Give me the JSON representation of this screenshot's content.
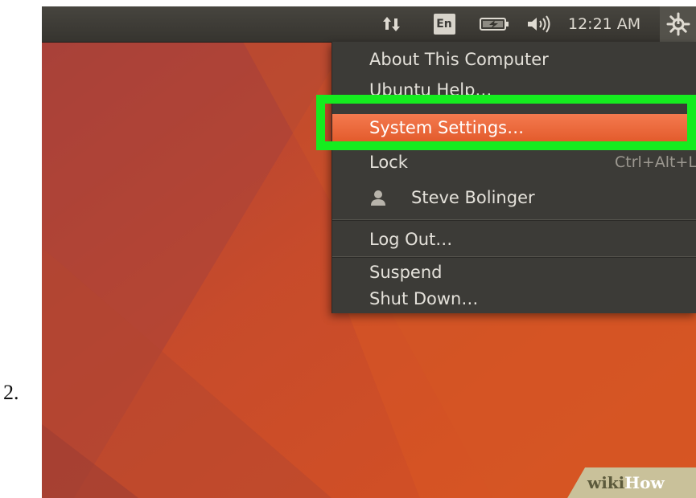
{
  "step": {
    "number": "2."
  },
  "panel": {
    "clock": "12:21 AM",
    "keyboard_layout": "En",
    "icons": [
      "network-updown-icon",
      "keyboard-layout-icon",
      "battery-charging-icon",
      "volume-icon",
      "session-gear-icon"
    ]
  },
  "menu": {
    "items": [
      {
        "label": "About This Computer"
      },
      {
        "label": "Ubuntu Help…"
      },
      {
        "label": "System Settings…",
        "highlighted": true
      },
      {
        "label": "Lock",
        "shortcut": "Ctrl+Alt+L"
      },
      {
        "label": "Steve Bolinger",
        "icon": "user-icon"
      },
      {
        "label": "Log Out…"
      },
      {
        "label": "Suspend"
      },
      {
        "label": "Shut Down…"
      }
    ]
  },
  "watermark": {
    "part1": "wiki",
    "part2": "How"
  },
  "colors": {
    "panel": "#3c3b37",
    "menu_bg": "#3c3b37",
    "menu_highlight": "#f07746",
    "callout_green": "#15ec1f",
    "desktop": "#c2482a"
  }
}
